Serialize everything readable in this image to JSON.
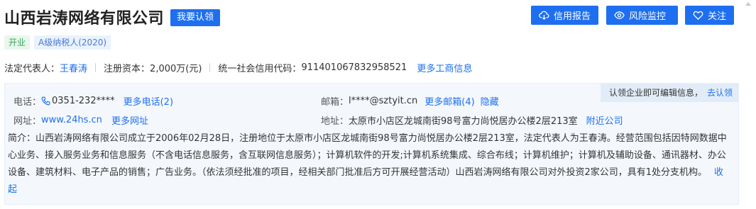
{
  "company": {
    "name": "山西岩涛网络有限公司",
    "claim_button": "我要认领"
  },
  "actions": {
    "report": "信用报告",
    "monitor": "风险监控",
    "follow": "关注"
  },
  "tags": {
    "status": "开业",
    "tax": "A级纳税人(2020)"
  },
  "registration": {
    "legal_rep_label": "法定代表人：",
    "legal_rep": "王春涛",
    "capital_label": "注册资本：",
    "capital": "2,000万(元)",
    "credit_code_label": "统一社会信用代码：",
    "credit_code": "911401067832958521",
    "more_info": "更多工商信息"
  },
  "contact": {
    "claim_tip": "认领企业即可编辑信息，",
    "claim_link": "去认领",
    "phone_label": "电话：",
    "phone": "0351-232****",
    "more_phone": "更多电话(2)",
    "email_label": "邮箱：",
    "email": "l****@sztyit.cn",
    "more_email": "更多邮箱(4)",
    "hide": "隐藏",
    "website_label": "网址：",
    "website": "www.24hs.cn",
    "more_website": "更多网址",
    "address_label": "地址：",
    "address": "太原市小店区龙城南街98号富力尚悦居办公楼2层213室",
    "nearby": "附近公司",
    "intro_label": "简介：",
    "intro": "山西岩涛网络有限公司成立于2006年02月28日，注册地位于太原市小店区龙城南街98号富力尚悦居办公楼2层213室，法定代表人为王春涛。经营范围包括因特网数据中心业务、接入服务业务和信息服务（不含电话信息服务，含互联网信息服务）；计算机软件的开发;计算机系统集成、综合布线；计算机维护；计算机及辅助设备、通讯器材、办公设备、建筑材料、电子产品的销售；广告业务。（依法须经批准的项目，经相关部门批准后方可开展经营活动）山西岩涛网络有限公司对外投资2家公司，具有1处分支机构。",
    "collapse": "收起"
  },
  "colors": {
    "accent": "#1e6ff0",
    "status_green": "#3aa55b",
    "panel_bg": "#f4f8fd"
  }
}
